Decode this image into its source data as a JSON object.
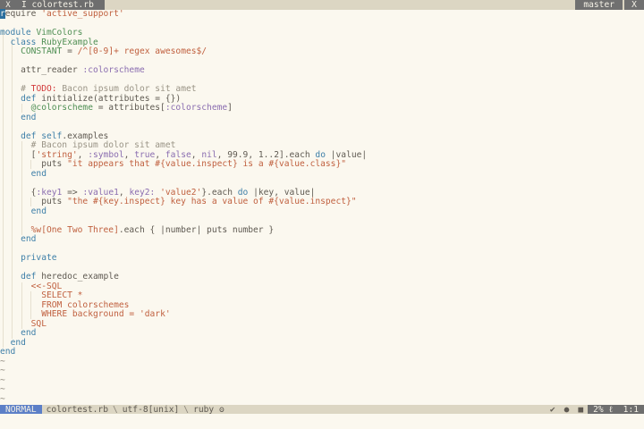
{
  "tabline": {
    "close_left": "X",
    "current_tab": "I colortest.rb",
    "branch": "master",
    "close_right": "X"
  },
  "code": {
    "l01": {
      "a": "r",
      "b": "equire",
      "c": "'active_support'"
    },
    "l03": {
      "a": "module",
      "b": "VimColors"
    },
    "l04": {
      "a": "class",
      "b": "RubyExample"
    },
    "l05": {
      "a": "CONSTANT",
      "b": "=",
      "c": "/^[0-9]+ regex awesomes$/"
    },
    "l07": {
      "a": "attr_reader",
      "b": ":colorscheme"
    },
    "l09": {
      "a": "#",
      "b": "TODO:",
      "c": "Bacon ipsum dolor sit amet"
    },
    "l10": {
      "a": "def",
      "b": "initialize(attributes = {})"
    },
    "l11": {
      "a": "@colorscheme",
      "b": "= attributes[",
      "c": ":colorscheme",
      "d": "]"
    },
    "l12": {
      "a": "end"
    },
    "l14": {
      "a": "def",
      "b": "self",
      "c": ".examples"
    },
    "l15": {
      "a": "# Bacon ipsum dolor sit amet"
    },
    "l16": {
      "a": "[",
      "b": "'string'",
      "c": ", ",
      "d": ":symbol",
      "e": ", ",
      "f": "true",
      "g": ", ",
      "h": "false",
      "i": ", ",
      "j": "nil",
      "k": ", 99.9, 1..2].each ",
      "l": "do",
      "m": " |value|"
    },
    "l17": {
      "a": "puts",
      "b": "\"it appears that #{value.inspect} is a #{value.class}\""
    },
    "l18": {
      "a": "end"
    },
    "l20": {
      "a": "{",
      "b": ":key1",
      "c": " => ",
      "d": ":value1",
      "e": ", ",
      "f": "key2:",
      "g": " ",
      "h": "'value2'",
      "i": "}.each ",
      "j": "do",
      "k": " |key, value|"
    },
    "l21": {
      "a": "puts",
      "b": "\"the #{key.inspect} key has a value of #{value.inspect}\""
    },
    "l22": {
      "a": "end"
    },
    "l24": {
      "a": "%w[One Two Three]",
      "b": ".each { |number| puts number }"
    },
    "l25": {
      "a": "end"
    },
    "l27": {
      "a": "private"
    },
    "l29": {
      "a": "def",
      "b": "heredoc_example"
    },
    "l30": {
      "a": "<<-SQL"
    },
    "l31": {
      "a": "SELECT *"
    },
    "l32": {
      "a": "FROM colorschemes"
    },
    "l33": {
      "a": "WHERE background = 'dark'"
    },
    "l34": {
      "a": "SQL"
    },
    "l35": {
      "a": "end"
    },
    "l36": {
      "a": "end"
    },
    "l37": {
      "a": "end"
    },
    "tilde": "~"
  },
  "statusline": {
    "mode": "NORMAL",
    "filename": "colortest.rb",
    "encoding": "utf-8[unix]",
    "filetype": "ruby",
    "filetype_icon": "ʘ",
    "check": "✔",
    "dot": "●",
    "square": "■",
    "percent": "2%",
    "ln_icon": "ℓ",
    "position": "1:1"
  },
  "colors": {
    "background": "#fbf8ef",
    "keyword": "#3e7fa8",
    "string": "#c0603f",
    "symbol": "#8a6db0",
    "comment": "#9a9486",
    "todo": "#d23b3b",
    "constant": "#4f8f54",
    "mode_bg": "#5c7fc7"
  }
}
